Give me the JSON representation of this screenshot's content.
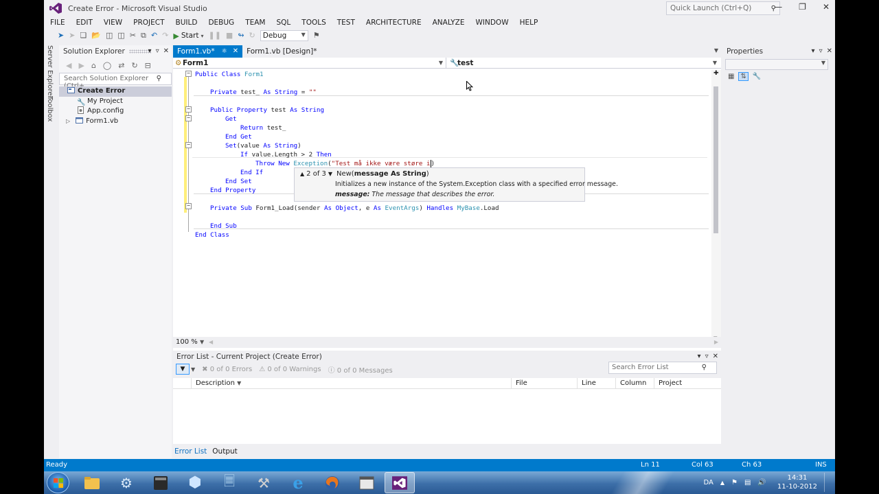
{
  "window": {
    "title": "Create Error - Microsoft Visual Studio",
    "quick_launch_placeholder": "Quick Launch (Ctrl+Q)"
  },
  "menu": [
    "FILE",
    "EDIT",
    "VIEW",
    "PROJECT",
    "BUILD",
    "DEBUG",
    "TEAM",
    "SQL",
    "TOOLS",
    "TEST",
    "ARCHITECTURE",
    "ANALYZE",
    "WINDOW",
    "HELP"
  ],
  "toolbar": {
    "start_label": "Start",
    "config": "Debug"
  },
  "side_strip": {
    "server_explorer": "Server Explorer",
    "toolbox": "Toolbox"
  },
  "solution_explorer": {
    "title": "Solution Explorer",
    "search_placeholder": "Search Solution Explorer (Ctrl+",
    "root": "Create Error",
    "items": [
      "My Project",
      "App.config",
      "Form1.vb"
    ]
  },
  "editor": {
    "tabs": [
      {
        "label": "Form1.vb*"
      },
      {
        "label": "Form1.vb [Design]*"
      }
    ],
    "nav_left": "Form1",
    "nav_right": "test",
    "zoom": "100 %",
    "tooltip": {
      "counter": "2 of 3",
      "sig_name": "New(",
      "sig_params": "message As String",
      "sig_end": ")",
      "desc": "Initializes a new instance of the System.Exception class with a specified error message.",
      "param_name": "message:",
      "param_desc": " The message that describes the error."
    }
  },
  "code": {
    "l1_kw": "Public Class ",
    "l1_ty": "Form1",
    "l2_kw": "Private ",
    "l2_id": "test_ ",
    "l2_kw2": "As String",
    "l2_rest": " = ",
    "l2_str": "\"\"",
    "l3_kw": "Public Property ",
    "l3_id": "test ",
    "l3_kw2": "As String",
    "l4": "Get",
    "l5_kw": "Return ",
    "l5_id": "test_",
    "l6": "End Get",
    "l7_kw": "Set",
    "l7_p1": "(value ",
    "l7_kw2": "As String",
    "l7_p2": ")",
    "l8_kw": "If ",
    "l8_id": "value.Length > 2 ",
    "l8_kw2": "Then",
    "l9_kw": "Throw New ",
    "l9_ty": "Exception",
    "l9_p": "(",
    "l9_str": "\"Test må ikke være støre i",
    "l9_end": ")",
    "l10": "End If",
    "l11": "End Set",
    "l12": "End Property",
    "l13_kw": "Private Sub ",
    "l13_id": "Form1_Load(sender ",
    "l13_kw2": "As Object",
    "l13_c": ", e ",
    "l13_kw3": "As ",
    "l13_ty": "EventArgs",
    "l13_c2": ") ",
    "l13_kw4": "Handles ",
    "l13_id2": "MyBase",
    "l13_end": ".Load",
    "l14": "End Sub",
    "l15": "End Class"
  },
  "properties": {
    "title": "Properties"
  },
  "error_list": {
    "title": "Error List - Current Project (Create Error)",
    "errors": "0 of 0 Errors",
    "warnings": "0 of 0 Warnings",
    "messages": "0 of 0 Messages",
    "search_placeholder": "Search Error List",
    "columns": [
      "Description",
      "File",
      "Line",
      "Column",
      "Project"
    ],
    "tabs": [
      "Error List",
      "Output"
    ]
  },
  "status": {
    "ready": "Ready",
    "ln": "Ln 11",
    "col": "Col 63",
    "ch": "Ch 63",
    "mode": "INS"
  },
  "tray": {
    "lang": "DA",
    "time": "14:31",
    "date": "11-10-2012"
  },
  "colors": {
    "accent": "#007acc",
    "keyword": "#0000ff",
    "type": "#2b91af",
    "string": "#a31515"
  }
}
